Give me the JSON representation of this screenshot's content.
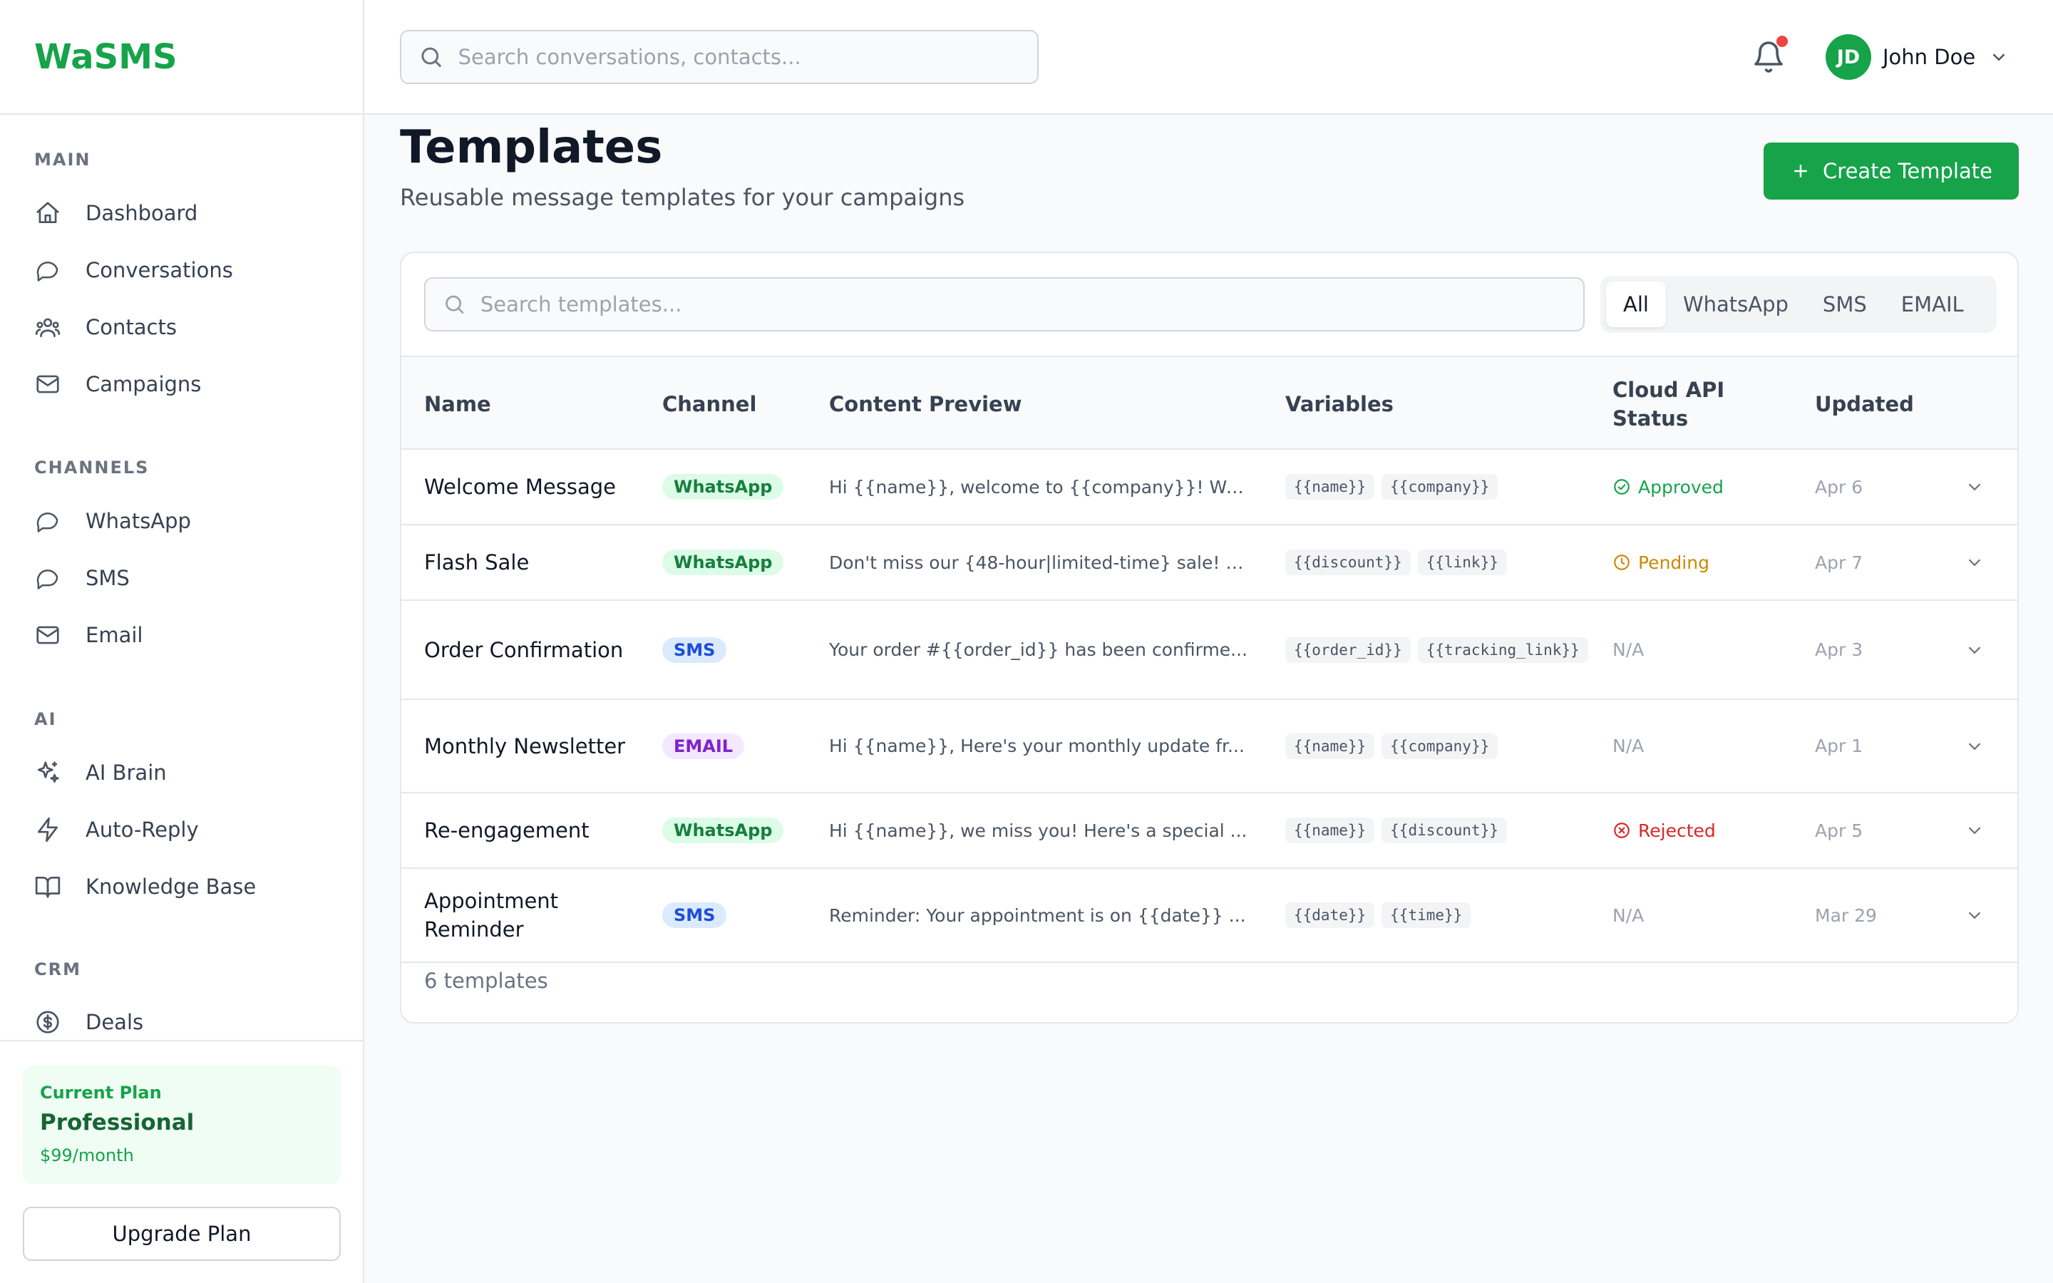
{
  "brand": "WaSMS",
  "nav": {
    "sections": [
      {
        "label": "MAIN",
        "items": [
          "Dashboard",
          "Conversations",
          "Contacts",
          "Campaigns"
        ]
      },
      {
        "label": "CHANNELS",
        "items": [
          "WhatsApp",
          "SMS",
          "Email"
        ]
      },
      {
        "label": "AI",
        "items": [
          "AI Brain",
          "Auto-Reply",
          "Knowledge Base"
        ]
      },
      {
        "label": "CRM",
        "items": [
          "Deals"
        ]
      }
    ]
  },
  "plan": {
    "label": "Current Plan",
    "name": "Professional",
    "price": "$99/month",
    "upgrade_label": "Upgrade Plan"
  },
  "header": {
    "search_placeholder": "Search conversations, contacts...",
    "user_initials": "JD",
    "user_name": "John Doe"
  },
  "page": {
    "title": "Templates",
    "subtitle": "Reusable message templates for your campaigns",
    "create_label": "Create Template"
  },
  "templates": {
    "search_placeholder": "Search templates...",
    "filters": [
      "All",
      "WhatsApp",
      "SMS",
      "EMAIL"
    ],
    "active_filter": "All",
    "columns": [
      "Name",
      "Channel",
      "Content Preview",
      "Variables",
      "Cloud API Status",
      "Updated"
    ],
    "rows": [
      {
        "name": "Welcome Message",
        "channel": "WhatsApp",
        "preview": "Hi {{name}}, welcome to {{company}}! We...",
        "vars": [
          "{{name}}",
          "{{company}}"
        ],
        "status": "Approved",
        "updated": "Apr 6"
      },
      {
        "name": "Flash Sale",
        "channel": "WhatsApp",
        "preview": "Don't miss our {48-hour|limited-time} sale! U...",
        "vars": [
          "{{discount}}",
          "{{link}}"
        ],
        "status": "Pending",
        "updated": "Apr 7"
      },
      {
        "name": "Order Confirmation",
        "channel": "SMS",
        "preview": "Your order #{{order_id}} has been confirme...",
        "vars": [
          "{{order_id}}",
          "{{tracking_link}}"
        ],
        "status": "N/A",
        "updated": "Apr 3"
      },
      {
        "name": "Monthly Newsletter",
        "channel": "EMAIL",
        "preview": "Hi {{name}}, Here's your monthly update fr...",
        "vars": [
          "{{name}}",
          "{{company}}"
        ],
        "status": "N/A",
        "updated": "Apr 1"
      },
      {
        "name": "Re-engagement",
        "channel": "WhatsApp",
        "preview": "Hi {{name}}, we miss you! Here's a special ...",
        "vars": [
          "{{name}}",
          "{{discount}}"
        ],
        "status": "Rejected",
        "updated": "Apr 5"
      },
      {
        "name": "Appointment Reminder",
        "channel": "SMS",
        "preview": "Reminder: Your appointment is on {{date}} ...",
        "vars": [
          "{{date}}",
          "{{time}}"
        ],
        "status": "N/A",
        "updated": "Mar 29"
      }
    ],
    "count_label": "6 templates"
  },
  "icons": {
    "Dashboard": "home-icon",
    "Conversations": "chat-icon",
    "Contacts": "users-icon",
    "Campaigns": "mail-icon",
    "WhatsApp": "chat-icon",
    "SMS": "chat-icon",
    "Email": "mail-icon",
    "AI Brain": "sparkles-icon",
    "Auto-Reply": "bolt-icon",
    "Knowledge Base": "book-icon",
    "Deals": "dollar-icon"
  },
  "colors": {
    "brand": "#16a34a",
    "approved": "#16a34a",
    "pending": "#ca8a04",
    "rejected": "#dc2626",
    "notification": "#ef4444"
  }
}
